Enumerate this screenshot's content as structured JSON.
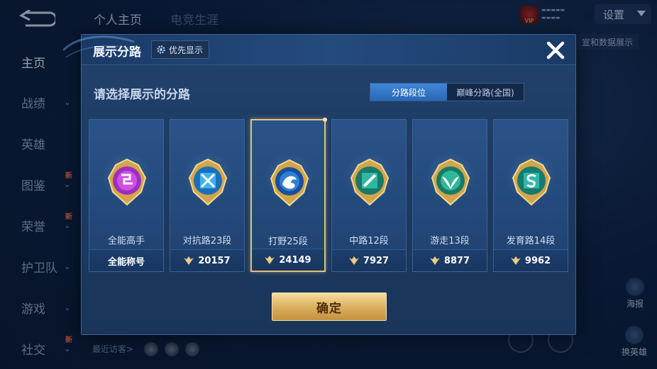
{
  "sidebar": {
    "items": [
      {
        "label": "主页",
        "active": true,
        "chevron": false,
        "new": false
      },
      {
        "label": "战绩",
        "active": false,
        "chevron": true,
        "new": false
      },
      {
        "label": "英雄",
        "active": false,
        "chevron": false,
        "new": false
      },
      {
        "label": "图鉴",
        "active": false,
        "chevron": true,
        "new": true
      },
      {
        "label": "荣誉",
        "active": false,
        "chevron": true,
        "new": true
      },
      {
        "label": "护卫队",
        "active": false,
        "chevron": true,
        "new": false
      },
      {
        "label": "游戏",
        "active": false,
        "chevron": true,
        "new": false
      },
      {
        "label": "社交",
        "active": false,
        "chevron": true,
        "new": true
      }
    ],
    "new_badge": "新"
  },
  "top_tabs": [
    "个人主页",
    "电竞生涯"
  ],
  "header_right": {
    "settings_label": "设置",
    "data_show_label": "宣和数据展示"
  },
  "right_buttons": {
    "poster": "海报",
    "switch_hero": "换英雄"
  },
  "recent_visitors_label": "最近访客>",
  "modal": {
    "title": "展示分路",
    "priority_label": "优先显示",
    "prompt": "请选择展示的分路",
    "toggle": {
      "active": "分路段位",
      "inactive": "巅峰分路(全国)"
    },
    "cards": [
      {
        "name": "全能高手",
        "bottom": "全能称号",
        "points": null,
        "badge": "all-round-badge-icon",
        "color": "#b63bd0",
        "selected": false
      },
      {
        "name": "对抗路23段",
        "bottom": "20157",
        "points": 20157,
        "badge": "clash-lane-badge-icon",
        "color": "#2f9fe0",
        "selected": false
      },
      {
        "name": "打野25段",
        "bottom": "24149",
        "points": 24149,
        "badge": "jungle-badge-icon",
        "color": "#2f7fd8",
        "selected": true
      },
      {
        "name": "中路12段",
        "bottom": "7927",
        "points": 7927,
        "badge": "mid-lane-badge-icon",
        "color": "#2fb8a0",
        "selected": false
      },
      {
        "name": "游走13段",
        "bottom": "8877",
        "points": 8877,
        "badge": "roam-badge-icon",
        "color": "#2fb898",
        "selected": false
      },
      {
        "name": "发育路14段",
        "bottom": "9962",
        "points": 9962,
        "badge": "farm-lane-badge-icon",
        "color": "#2fb8a8",
        "selected": false
      }
    ],
    "confirm_label": "确定"
  },
  "colors": {
    "accent_gold": "#e1c27a",
    "toggle_active": "#3f86d8",
    "modal_bg": "#1d3b63"
  }
}
